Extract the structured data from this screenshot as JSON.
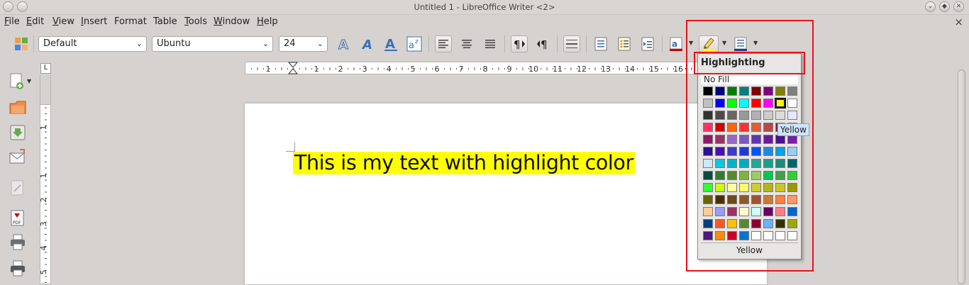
{
  "window": {
    "title": "Untitled 1 - LibreOffice Writer <2>"
  },
  "menubar": {
    "items": [
      {
        "first": "F",
        "rest": "ile"
      },
      {
        "first": "E",
        "rest": "dit"
      },
      {
        "first": "V",
        "rest": "iew"
      },
      {
        "first": "I",
        "rest": "nsert"
      },
      {
        "first": "",
        "rest": "Format"
      },
      {
        "first": "",
        "rest": "Table"
      },
      {
        "first": "T",
        "rest": "ools"
      },
      {
        "first": "W",
        "rest": "indow"
      },
      {
        "first": "H",
        "rest": "elp"
      }
    ],
    "close_doc": "×"
  },
  "toolbar": {
    "paragraph_style": "Default",
    "font_name": "Ubuntu",
    "font_size": "24",
    "combo_arrow": "⌄"
  },
  "ruler": {
    "h_numbers": [
      "1",
      "1",
      "2",
      "3",
      "4",
      "5",
      "6",
      "7",
      "8",
      "9",
      "10",
      "11",
      "12",
      "13",
      "14",
      "15",
      "16"
    ],
    "v_numbers": [
      "1",
      "1",
      "2",
      "3",
      "4",
      "5"
    ],
    "tab_marker": "L"
  },
  "document": {
    "text": "This is my text with highlight color",
    "highlight_color": "#ffff00"
  },
  "highlight_popup": {
    "title": "Highlighting",
    "no_fill": "No Fill",
    "selected_name": "Yellow",
    "tooltip": "Yellow",
    "swatches": [
      [
        "#000000",
        "#000080",
        "#008000",
        "#008080",
        "#800000",
        "#800080",
        "#808000",
        "#808080"
      ],
      [
        "#c0c0c0",
        "#0000ff",
        "#00ff00",
        "#00ffff",
        "#ff0000",
        "#ff00ff",
        "#ffff00",
        "#ffffff"
      ],
      [
        "#333333",
        "#4b4b4b",
        "#666666",
        "#999999",
        "#b2b2b2",
        "#cccccc",
        "#dddddd",
        "#e6e6ff"
      ],
      [
        "#ff3366",
        "#cc0000",
        "#ff6600",
        "#ff3333",
        "#e05d3a",
        "#b84747",
        "#8b1a4d",
        "#6a1b9a"
      ],
      [
        "#8b1a6b",
        "#993366",
        "#9966cc",
        "#7e57c2",
        "#5e35b1",
        "#6a1b9a",
        "#4a148c",
        "#7b1fa2"
      ],
      [
        "#2e0f8f",
        "#4a0fb0",
        "#3d3dcc",
        "#1e3ad6",
        "#0055ff",
        "#1e88e5",
        "#00a0e8",
        "#99ccff"
      ],
      [
        "#cce8f4",
        "#00c8e0",
        "#00b4c8",
        "#00acc1",
        "#26a69a",
        "#1e9e8a",
        "#1b8c7a",
        "#006666"
      ],
      [
        "#004d40",
        "#2e7d32",
        "#558b2f",
        "#7cb342",
        "#9ccc65",
        "#00c853",
        "#43a047",
        "#33cc33"
      ],
      [
        "#33ff33",
        "#ccff00",
        "#ffff99",
        "#ffff66",
        "#cccc33",
        "#b5b51a",
        "#c8c81e",
        "#999900"
      ],
      [
        "#666600",
        "#4a3000",
        "#6b4a1a",
        "#8b5a2b",
        "#a0522d",
        "#cc7a33",
        "#ff7f3f",
        "#ff9966"
      ],
      [
        "#ffcc99",
        "#9999ff",
        "#993366",
        "#ffffcc",
        "#ccffff",
        "#660066",
        "#ff8080",
        "#0066cc"
      ],
      [
        "#004080",
        "#ff5722",
        "#ffc107",
        "#558b2f",
        "#8b0033",
        "#66b3ff",
        "#333300",
        "#99aa00"
      ],
      [
        "#4b1a7a",
        "#ff8c00",
        "#cc0022",
        "#0077cc",
        "#ffffff",
        "#ffffff",
        "#ffffff",
        "#ffffff"
      ]
    ]
  },
  "colors": {
    "annotation_red": "#e8131c",
    "tooltip_bg": "#cfe4f7"
  }
}
